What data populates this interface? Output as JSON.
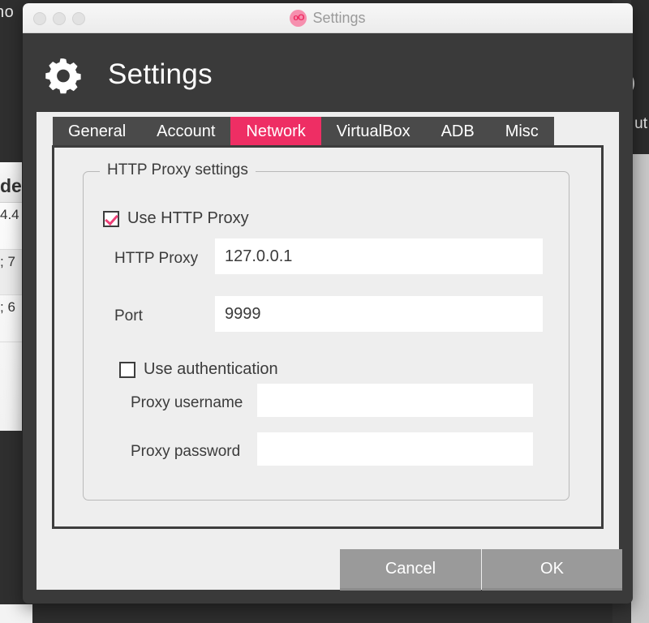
{
  "background": {
    "left_fragment_text": "no",
    "right_fragment_text": "ut",
    "list_header_fragment": "de",
    "list_rows": [
      {
        "text": "4.4"
      },
      {
        "text": "; 7"
      },
      {
        "text": "; 6"
      }
    ]
  },
  "window": {
    "title": "Settings",
    "logo_glyph": "oO",
    "traffic_lights": {
      "close": "close-button",
      "minimize": "minimize-button",
      "maximize": "maximize-button"
    }
  },
  "header": {
    "icon": "gear-icon",
    "title": "Settings"
  },
  "tabs": [
    {
      "label": "General",
      "active": false
    },
    {
      "label": "Account",
      "active": false
    },
    {
      "label": "Network",
      "active": true
    },
    {
      "label": "VirtualBox",
      "active": false
    },
    {
      "label": "ADB",
      "active": false
    },
    {
      "label": "Misc",
      "active": false
    }
  ],
  "proxy_group": {
    "legend": "HTTP Proxy settings",
    "use_http_proxy": {
      "label": "Use HTTP Proxy",
      "checked": true
    },
    "http_proxy": {
      "label": "HTTP Proxy",
      "value": "127.0.0.1",
      "placeholder": ""
    },
    "port": {
      "label": "Port",
      "value": "9999",
      "placeholder": ""
    },
    "use_authentication": {
      "label": "Use authentication",
      "checked": false
    },
    "proxy_username": {
      "label": "Proxy username",
      "value": "",
      "placeholder": ""
    },
    "proxy_password": {
      "label": "Proxy password",
      "value": "",
      "placeholder": ""
    }
  },
  "footer": {
    "cancel_label": "Cancel",
    "ok_label": "OK"
  },
  "colors": {
    "accent_pink": "#ee2e64",
    "logo_pink": "#f68fae",
    "header_dark": "#3a3a3a",
    "panel_gray": "#eeeeee",
    "button_gray": "#9a9a9a",
    "check_pink": "#ee3f77"
  }
}
